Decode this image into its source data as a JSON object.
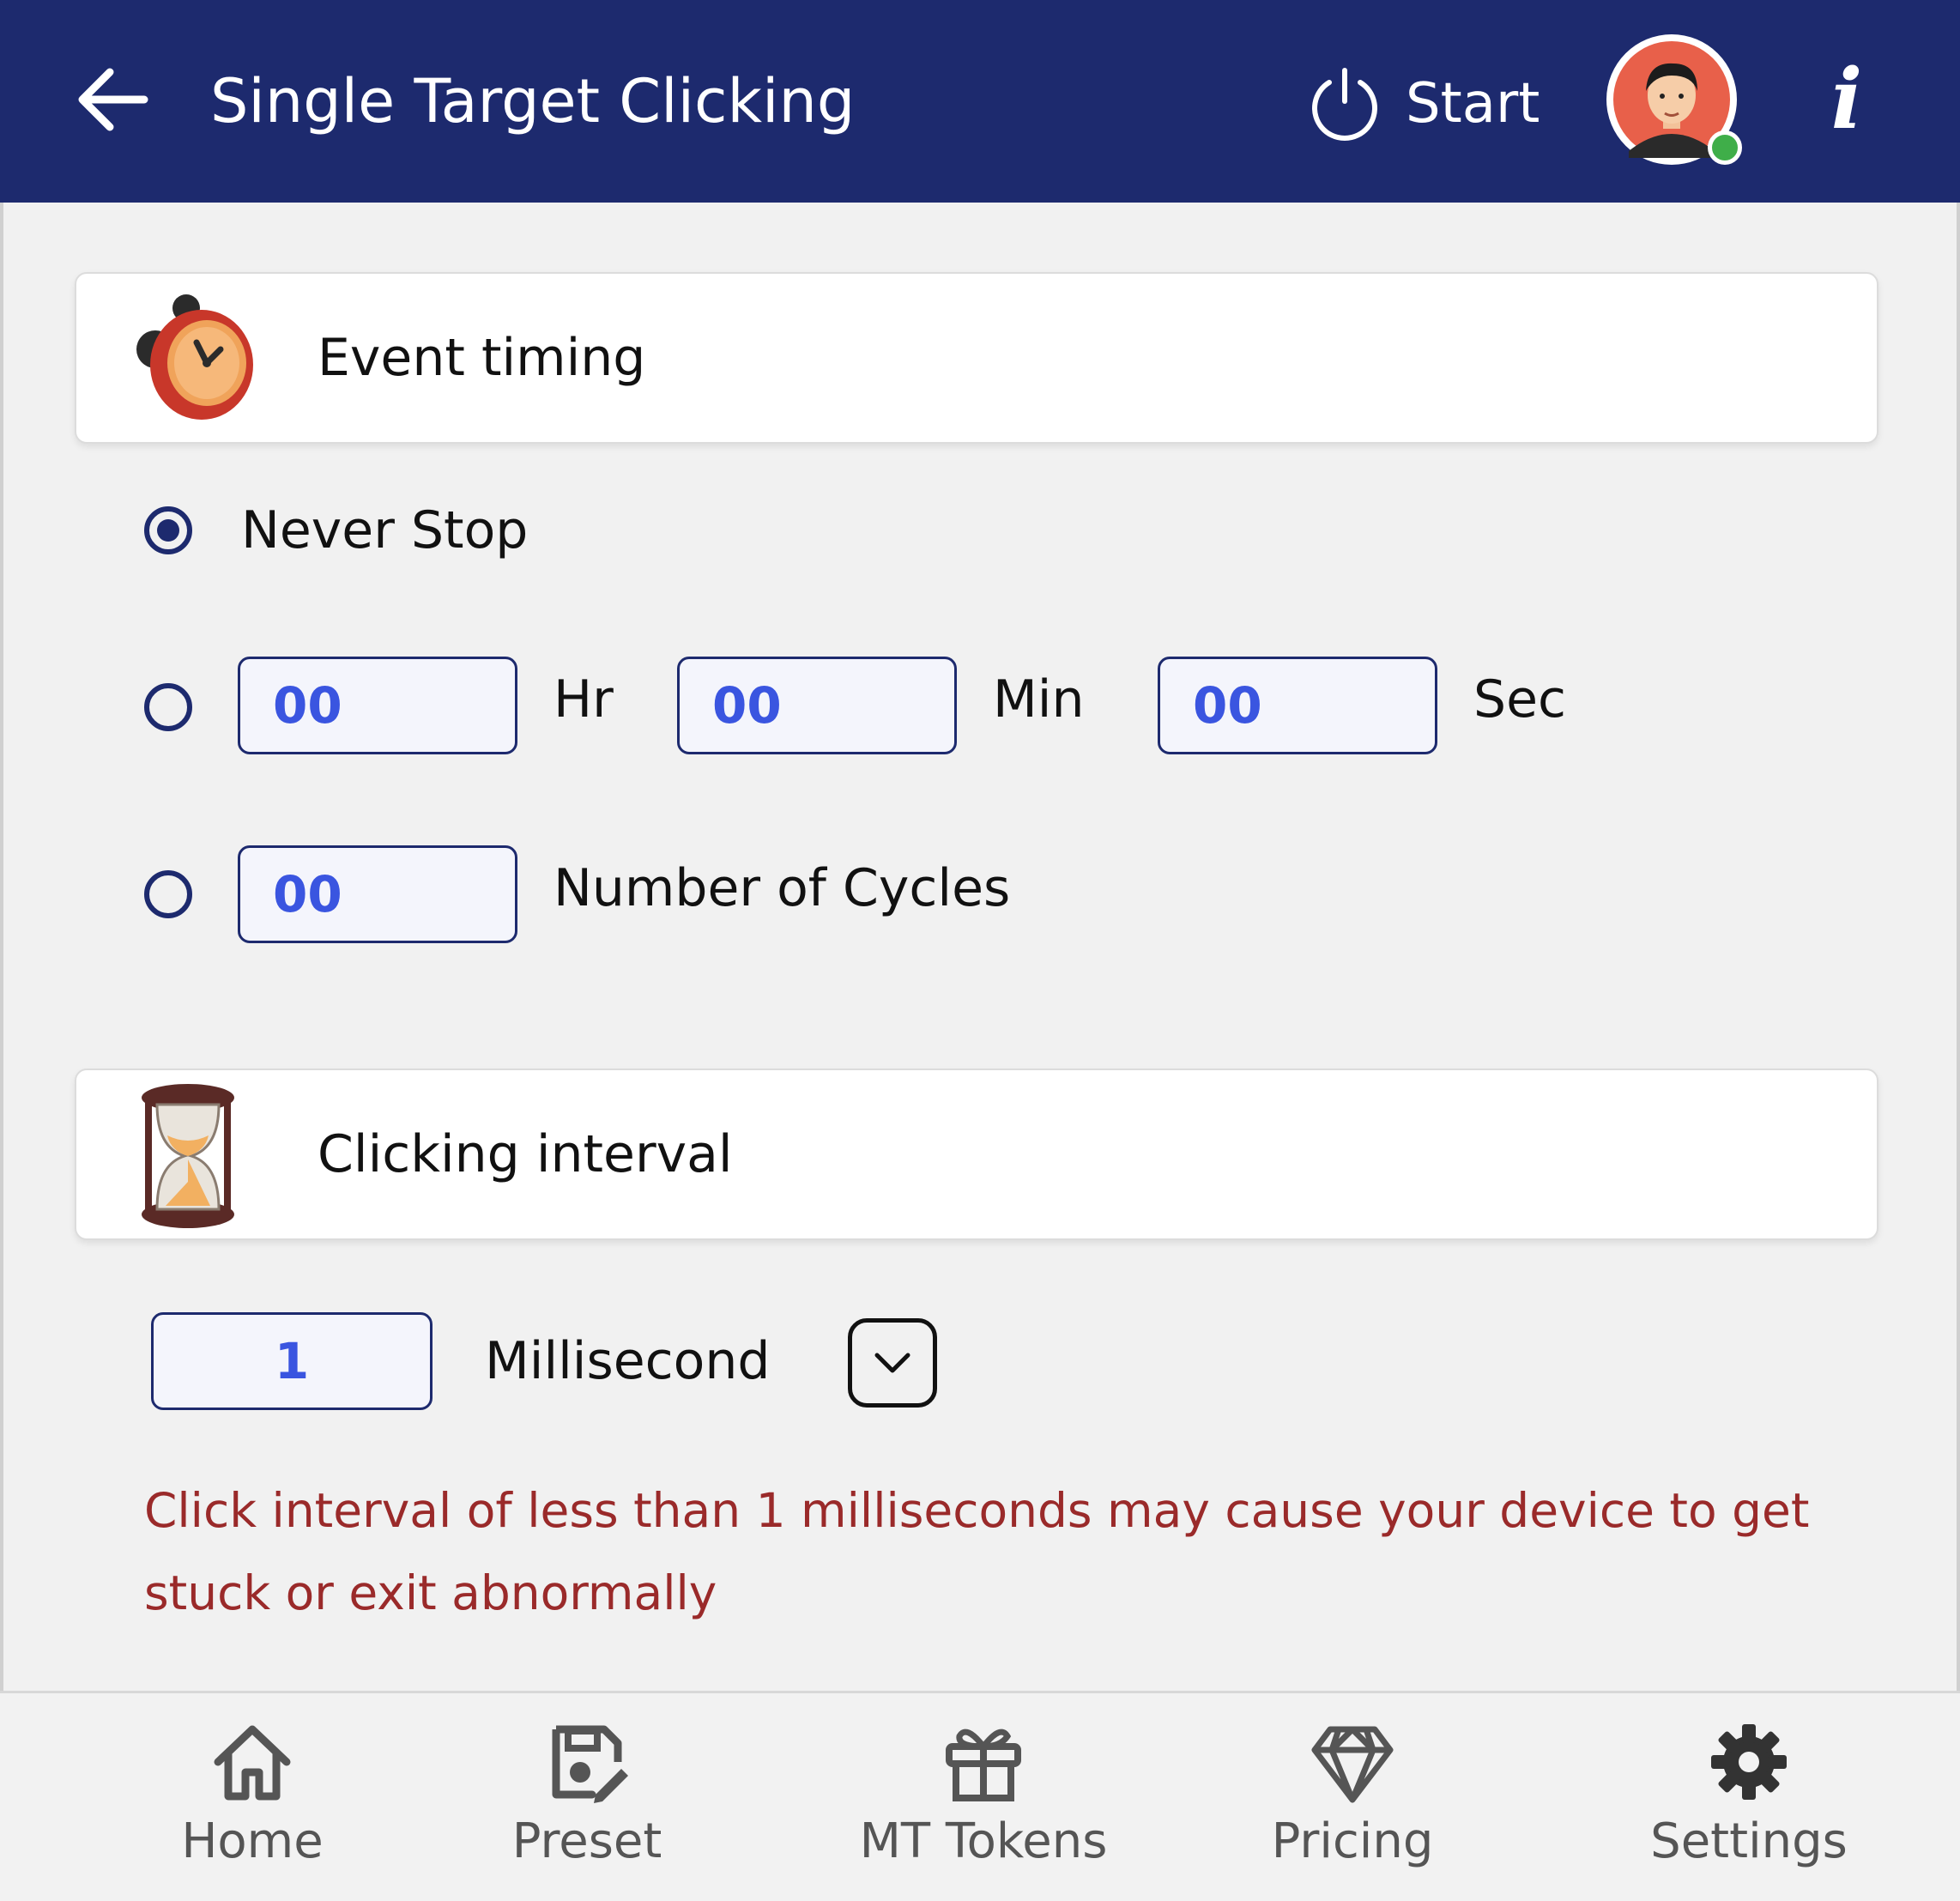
{
  "header": {
    "title": "Single Target Clicking",
    "start_label": "Start",
    "icons": {
      "back": "back-arrow-icon",
      "power": "power-icon",
      "avatar": "avatar",
      "info": "info-icon"
    },
    "status": "online",
    "colors": {
      "bar": "#1d2a6e",
      "online": "#3fae49"
    }
  },
  "event_timing": {
    "title": "Event timing",
    "icon": "alarm-clock-icon",
    "never_stop_label": "Never Stop",
    "selected": "never_stop",
    "duration": {
      "hr_value": "00",
      "hr_label": "Hr",
      "min_value": "00",
      "min_label": "Min",
      "sec_value": "00",
      "sec_label": "Sec"
    },
    "cycles": {
      "value": "00",
      "label": "Number of Cycles"
    }
  },
  "clicking_interval": {
    "title": "Clicking interval",
    "icon": "hourglass-icon",
    "value": "1",
    "unit": "Millisecond",
    "warning": "Click interval of  less than 1 milliseconds may cause your device to get stuck or exit abnormally",
    "warning_color": "#9a2a2a"
  },
  "bottom_nav": [
    {
      "label": "Home",
      "icon": "home-icon"
    },
    {
      "label": "Preset",
      "icon": "preset-icon"
    },
    {
      "label": "MT Tokens",
      "icon": "gift-icon"
    },
    {
      "label": "Pricing",
      "icon": "diamond-icon"
    },
    {
      "label": "Settings",
      "icon": "gear-icon"
    }
  ]
}
